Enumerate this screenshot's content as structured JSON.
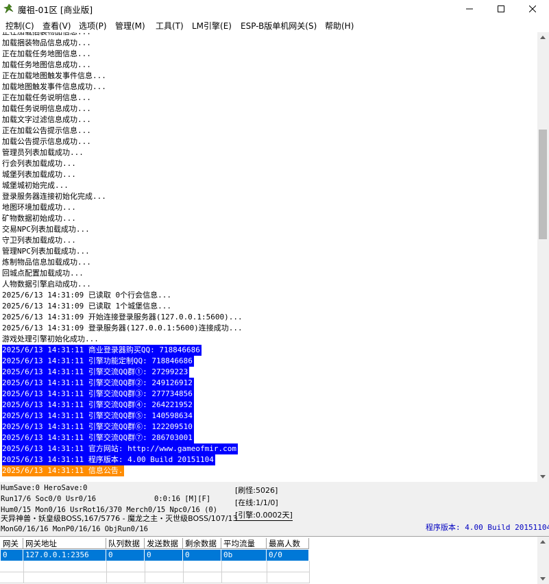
{
  "window": {
    "title": "魔祖-01区 [商业版]"
  },
  "menu": [
    "控制(C)",
    "查看(V)",
    "选项(P)",
    "管理(M)",
    "工具(T)",
    "LM引擎(E)",
    "ESP-B版单机网关(S)",
    "帮助(H)"
  ],
  "log_lines": [
    {
      "text": "正在加载捆装物品信息...",
      "hl": ""
    },
    {
      "text": "加载捆装物品信息成功...",
      "hl": ""
    },
    {
      "text": "正在加载任务地图信息...",
      "hl": ""
    },
    {
      "text": "加载任务地图信息成功...",
      "hl": ""
    },
    {
      "text": "正在加载地图触发事件信息...",
      "hl": ""
    },
    {
      "text": "加载地图触发事件信息成功...",
      "hl": ""
    },
    {
      "text": "正在加载任务说明信息...",
      "hl": ""
    },
    {
      "text": "加载任务说明信息成功...",
      "hl": ""
    },
    {
      "text": "加载文字过滤信息成功...",
      "hl": ""
    },
    {
      "text": "正在加载公告提示信息...",
      "hl": ""
    },
    {
      "text": "加载公告提示信息成功...",
      "hl": ""
    },
    {
      "text": "管理员列表加载成功...",
      "hl": ""
    },
    {
      "text": "行会列表加载成功...",
      "hl": ""
    },
    {
      "text": "城堡列表加载成功...",
      "hl": ""
    },
    {
      "text": "城堡城初始完成...",
      "hl": ""
    },
    {
      "text": "登录服务器连接初始化完成...",
      "hl": ""
    },
    {
      "text": "地图环境加载成功...",
      "hl": ""
    },
    {
      "text": "矿物数据初始成功...",
      "hl": ""
    },
    {
      "text": "交易NPC列表加载成功...",
      "hl": ""
    },
    {
      "text": "守卫列表加载成功...",
      "hl": ""
    },
    {
      "text": "管理NPC列表加载成功...",
      "hl": ""
    },
    {
      "text": "炼制物品信息加载成功...",
      "hl": ""
    },
    {
      "text": "回城点配置加载成功...",
      "hl": ""
    },
    {
      "text": "人物数据引擎启动成功...",
      "hl": ""
    },
    {
      "text": "2025/6/13 14:31:09 已读取 0个行会信息...",
      "hl": ""
    },
    {
      "text": "2025/6/13 14:31:09 已读取 1个城堡信息...",
      "hl": ""
    },
    {
      "text": "2025/6/13 14:31:09 开始连接登录服务器(127.0.0.1:5600)...",
      "hl": ""
    },
    {
      "text": "2025/6/13 14:31:09 登录服务器(127.0.0.1:5600)连接成功...",
      "hl": ""
    },
    {
      "text": "游戏处理引擎初始化成功...",
      "hl": ""
    },
    {
      "text": "2025/6/13 14:31:11 商业登录器购买QQ: 718846686",
      "hl": "blue"
    },
    {
      "text": "2025/6/13 14:31:11 引擎功能定制QQ: 718846686",
      "hl": "blue"
    },
    {
      "text": "2025/6/13 14:31:11 引擎交流QQ群①: 27299223",
      "hl": "blue"
    },
    {
      "text": "2025/6/13 14:31:11 引擎交流QQ群②: 249126912",
      "hl": "blue"
    },
    {
      "text": "2025/6/13 14:31:11 引擎交流QQ群③: 277734856",
      "hl": "blue"
    },
    {
      "text": "2025/6/13 14:31:11 引擎交流QQ群④: 264221952",
      "hl": "blue"
    },
    {
      "text": "2025/6/13 14:31:11 引擎交流QQ群⑤: 140598634",
      "hl": "blue"
    },
    {
      "text": "2025/6/13 14:31:11 引擎交流QQ群⑥: 122209510",
      "hl": "blue"
    },
    {
      "text": "2025/6/13 14:31:11 引擎交流QQ群⑦: 286703001",
      "hl": "blue"
    },
    {
      "text": "2025/6/13 14:31:11 官方网站: http://www.gameofmir.com",
      "hl": "blue"
    },
    {
      "text": "2025/6/13 14:31:11 程序版本: 4.00 Build 20151104",
      "hl": "blue"
    },
    {
      "text": "2025/6/13 14:31:11 信息公告.",
      "hl": "orange"
    }
  ],
  "status": {
    "line1": "HumSave:0 HeroSave:0",
    "line2a": "Run17/6 Soc0/0 Usr0/16",
    "line2b": "0:0:16 [M][F]",
    "line3": "Hum0/15 Mon0/16 UsrRot16/370 Merch0/15 Npc0/16 (0)",
    "line4": "天异神兽・妖皇级BOSS,167/5776 - 魔龙之主・灭世级BOSS/107/13",
    "line5": "MonG0/16/16 MonP0/16/16 ObjRun0/16",
    "refresh": "[刷怪:5026]",
    "online": "[在线:1/1/0]",
    "engine": "[引擎:0.0002天]",
    "version": "程序版本: 4.00 Build 20151104"
  },
  "grid": {
    "headers": [
      "网关",
      "网关地址",
      "队列数据",
      "发送数据",
      "剩余数据",
      "平均流量",
      "最高人数"
    ],
    "rows": [
      [
        "0",
        "127.0.0.1:2356",
        "0",
        "0",
        "0",
        "0b",
        "0/0"
      ]
    ]
  },
  "colors": {
    "highlight_blue": "#0000ff",
    "highlight_orange": "#ff8c00",
    "selection": "#0078d7",
    "version_text": "#0000c0"
  }
}
